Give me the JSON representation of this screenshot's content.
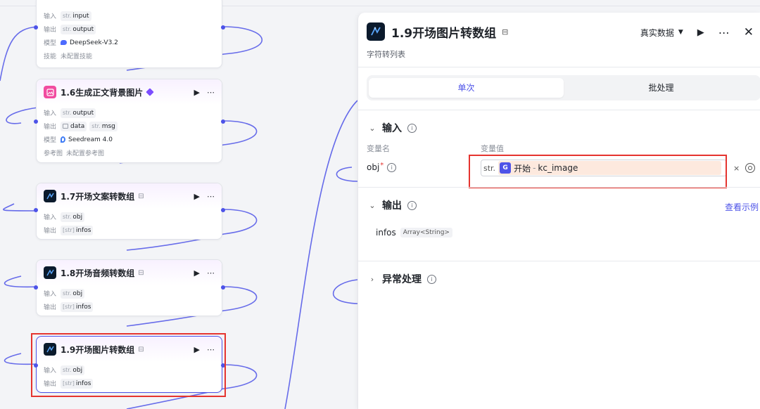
{
  "nodes": [
    {
      "id": "n15",
      "rows": [
        {
          "key": "输入",
          "tag_type": "str.",
          "value": "input"
        },
        {
          "key": "输出",
          "tag_type": "str.",
          "value": "output"
        },
        {
          "key": "模型",
          "model": "DeepSeek-V3.2"
        },
        {
          "key": "技能",
          "muted": "未配置技能"
        }
      ]
    },
    {
      "id": "n16",
      "title": "1.6生成正文背景图片",
      "rows": [
        {
          "key": "输入",
          "tag_type": "str.",
          "value": "output"
        },
        {
          "key": "输出",
          "out1": "data",
          "out2_type": "str.",
          "out2": "msg"
        },
        {
          "key": "模型",
          "model": "Seedream 4.0"
        },
        {
          "key": "参考图",
          "muted": "未配置参考图"
        }
      ]
    },
    {
      "id": "n17",
      "title": "1.7开场文案转数组",
      "rows": [
        {
          "key": "输入",
          "tag_type": "str.",
          "value": "obj"
        },
        {
          "key": "输出",
          "tag_type": "[str]",
          "value": "infos"
        }
      ]
    },
    {
      "id": "n18",
      "title": "1.8开场音频转数组",
      "rows": [
        {
          "key": "输入",
          "tag_type": "str.",
          "value": "obj"
        },
        {
          "key": "输出",
          "tag_type": "[str]",
          "value": "infos"
        }
      ]
    },
    {
      "id": "n19",
      "title": "1.9开场图片转数组",
      "rows": [
        {
          "key": "输入",
          "tag_type": "str.",
          "value": "obj"
        },
        {
          "key": "输出",
          "tag_type": "[str]",
          "value": "infos"
        }
      ]
    }
  ],
  "panel": {
    "title": "1.9开场图片转数组",
    "description": "字符转列表",
    "data_mode": "真实数据",
    "tabs": [
      "单次",
      "批处理"
    ],
    "active_tab": "单次",
    "input_section": "输入",
    "col_name": "变量名",
    "col_value": "变量值",
    "var_name": "obj",
    "var_type": "str.",
    "var_source": "开始",
    "var_ref": "kc_image",
    "output_section": "输出",
    "view_example": "查看示例",
    "output_name": "infos",
    "output_type": "Array<String>",
    "error_section": "异常处理"
  },
  "colors": {
    "accent": "#4d53e8",
    "highlight_border": "#e5342f",
    "chip_bg": "#fde9de",
    "node_header": "#f8f1ff"
  },
  "icons": [
    "workflow-node-icon",
    "image-gen-icon",
    "play-icon",
    "more-icon",
    "close-icon",
    "chevron-down-icon",
    "chevron-right-icon",
    "info-icon",
    "start-node-icon",
    "variable-picker-icon",
    "clear-icon",
    "save-icon",
    "premium-gem-icon",
    "deepseek-icon",
    "seedream-icon"
  ]
}
